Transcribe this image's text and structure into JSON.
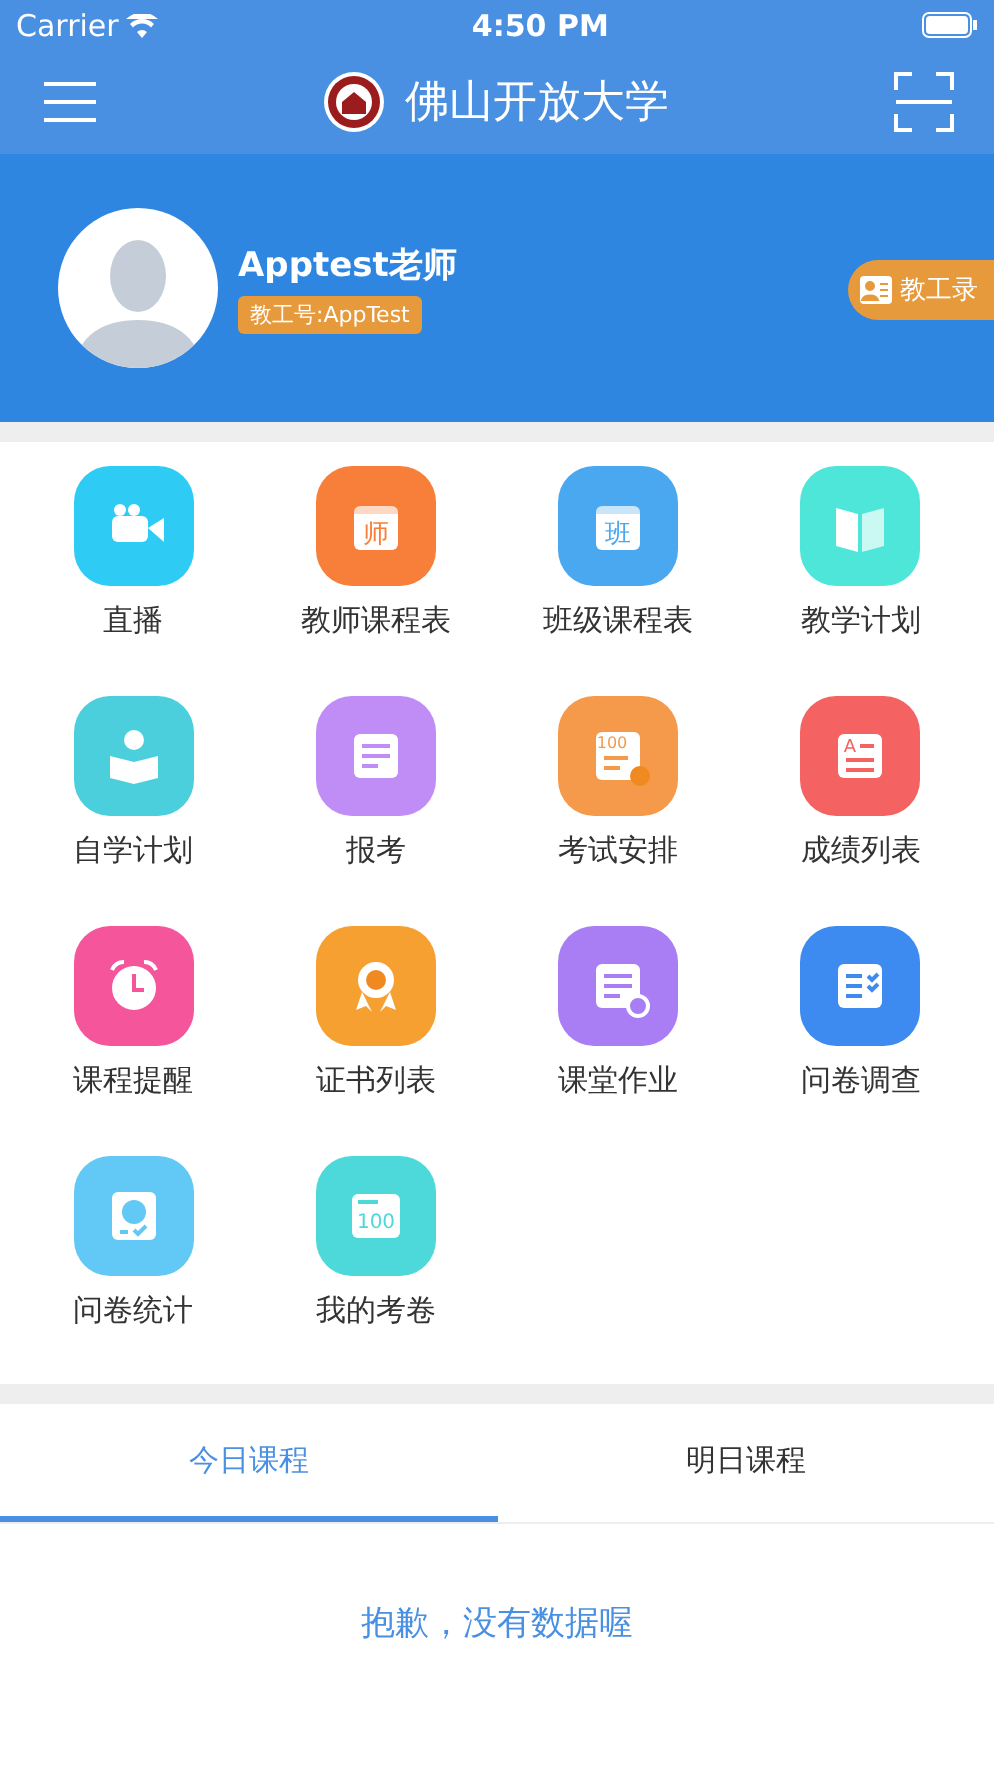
{
  "status_bar": {
    "carrier": "Carrier",
    "time": "4:50 PM"
  },
  "nav": {
    "title": "佛山开放大学"
  },
  "profile": {
    "name": "Apptest老师",
    "staff_id": "教工号:AppTest",
    "directory_button": "教工录"
  },
  "menu": [
    {
      "label": "直播",
      "kind": "camera",
      "color": "#2ecbf5"
    },
    {
      "label": "教师课程表",
      "kind": "calendar",
      "color": "#f77f3a",
      "glyph": "师"
    },
    {
      "label": "班级课程表",
      "kind": "calendar",
      "color": "#4aa8f0",
      "glyph": "班"
    },
    {
      "label": "教学计划",
      "kind": "book",
      "color": "#4de6d8"
    },
    {
      "label": "自学计划",
      "kind": "reader",
      "color": "#4ccfdc"
    },
    {
      "label": "报考",
      "kind": "form",
      "color": "#c08cf5"
    },
    {
      "label": "考试安排",
      "kind": "exam",
      "color": "#f59a4a",
      "glyph": "100"
    },
    {
      "label": "成绩列表",
      "kind": "grade",
      "color": "#f56262",
      "glyph": "A"
    },
    {
      "label": "课程提醒",
      "kind": "clock",
      "color": "#f5559a"
    },
    {
      "label": "证书列表",
      "kind": "award",
      "color": "#f5a030"
    },
    {
      "label": "课堂作业",
      "kind": "homework",
      "color": "#a97ef5"
    },
    {
      "label": "问卷调查",
      "kind": "survey",
      "color": "#3d8bf0"
    },
    {
      "label": "问卷统计",
      "kind": "chart",
      "color": "#62c8f5"
    },
    {
      "label": "我的考卷",
      "kind": "paper",
      "color": "#4dd9d9",
      "glyph": "100"
    }
  ],
  "tabs": [
    {
      "label": "今日课程",
      "selected": true
    },
    {
      "label": "明日课程",
      "selected": false
    }
  ],
  "empty_message": "抱歉，没有数据喔"
}
